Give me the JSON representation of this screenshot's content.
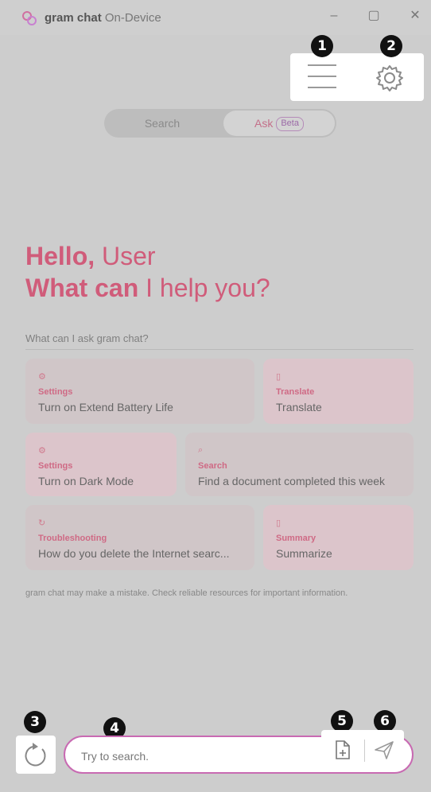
{
  "titlebar": {
    "app_name": "gram chat",
    "app_sub": "On-Device",
    "icons": [
      "app-logo-icon",
      "minimize-icon",
      "maximize-icon",
      "close-icon"
    ]
  },
  "toolbar": {
    "icons": [
      "hamburger-menu-icon",
      "gear-icon"
    ]
  },
  "mode_toggle": {
    "search_label": "Search",
    "ask_label": "Ask",
    "beta_label": "Beta",
    "selected": "Ask"
  },
  "greeting": {
    "hello": "Hello,",
    "name": "User",
    "question_bold": "What can",
    "question_rest": "I help you?"
  },
  "suggestions": {
    "heading": "What can I ask gram chat?",
    "cards": [
      {
        "category": "Settings",
        "text": "Turn on Extend Battery Life",
        "icon": "gear-icon"
      },
      {
        "category": "Translate",
        "text": "Translate",
        "icon": "document-icon"
      },
      {
        "category": "Settings",
        "text": "Turn on Dark Mode",
        "icon": "gear-icon"
      },
      {
        "category": "Search",
        "text": "Find a document completed this week",
        "icon": "search-icon"
      },
      {
        "category": "Troubleshooting",
        "text": "How do you delete the Internet searc...",
        "icon": "refresh-icon"
      },
      {
        "category": "Summary",
        "text": "Summarize",
        "icon": "document-icon"
      }
    ]
  },
  "disclaimer": "gram chat may make a mistake. Check reliable resources for important information.",
  "composer": {
    "placeholder": "Try to search.",
    "icons": [
      "refresh-icon",
      "attach-file-icon",
      "send-icon"
    ]
  },
  "callouts": [
    "1",
    "2",
    "3",
    "4",
    "5",
    "6"
  ],
  "colors": {
    "accent": "#d05c7a",
    "input_border": "#c86ab2",
    "overlay": "#cdcdcd"
  }
}
